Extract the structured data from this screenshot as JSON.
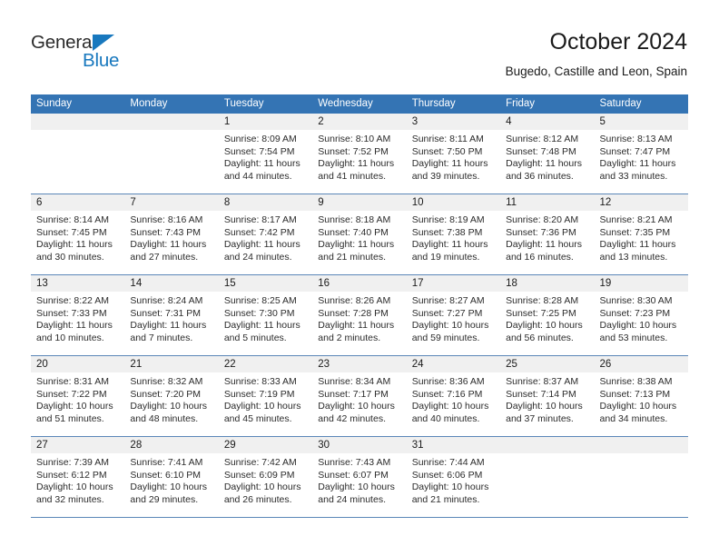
{
  "brand": {
    "name_part1": "General",
    "name_part2": "Blue",
    "accent_color": "#1878be",
    "triangle_icon": "triangle-right-icon"
  },
  "header": {
    "title": "October 2024",
    "subtitle": "Bugedo, Castille and Leon, Spain"
  },
  "theme": {
    "header_blue": "#3474b4",
    "day_band_gray": "#f0f0f0",
    "row_divider": "#5b87b8",
    "text": "#2b2b2b"
  },
  "weekdays": [
    "Sunday",
    "Monday",
    "Tuesday",
    "Wednesday",
    "Thursday",
    "Friday",
    "Saturday"
  ],
  "labels": {
    "sunrise_prefix": "Sunrise:",
    "sunset_prefix": "Sunset:",
    "daylight_prefix": "Daylight:"
  },
  "weeks": [
    [
      {
        "day": "",
        "empty": true,
        "l1": "",
        "l2": "",
        "l3": "",
        "l4": ""
      },
      {
        "day": "",
        "empty": true,
        "l1": "",
        "l2": "",
        "l3": "",
        "l4": ""
      },
      {
        "day": "1",
        "l1": "Sunrise: 8:09 AM",
        "l2": "Sunset: 7:54 PM",
        "l3": "Daylight: 11 hours",
        "l4": "and 44 minutes."
      },
      {
        "day": "2",
        "l1": "Sunrise: 8:10 AM",
        "l2": "Sunset: 7:52 PM",
        "l3": "Daylight: 11 hours",
        "l4": "and 41 minutes."
      },
      {
        "day": "3",
        "l1": "Sunrise: 8:11 AM",
        "l2": "Sunset: 7:50 PM",
        "l3": "Daylight: 11 hours",
        "l4": "and 39 minutes."
      },
      {
        "day": "4",
        "l1": "Sunrise: 8:12 AM",
        "l2": "Sunset: 7:48 PM",
        "l3": "Daylight: 11 hours",
        "l4": "and 36 minutes."
      },
      {
        "day": "5",
        "l1": "Sunrise: 8:13 AM",
        "l2": "Sunset: 7:47 PM",
        "l3": "Daylight: 11 hours",
        "l4": "and 33 minutes."
      }
    ],
    [
      {
        "day": "6",
        "l1": "Sunrise: 8:14 AM",
        "l2": "Sunset: 7:45 PM",
        "l3": "Daylight: 11 hours",
        "l4": "and 30 minutes."
      },
      {
        "day": "7",
        "l1": "Sunrise: 8:16 AM",
        "l2": "Sunset: 7:43 PM",
        "l3": "Daylight: 11 hours",
        "l4": "and 27 minutes."
      },
      {
        "day": "8",
        "l1": "Sunrise: 8:17 AM",
        "l2": "Sunset: 7:42 PM",
        "l3": "Daylight: 11 hours",
        "l4": "and 24 minutes."
      },
      {
        "day": "9",
        "l1": "Sunrise: 8:18 AM",
        "l2": "Sunset: 7:40 PM",
        "l3": "Daylight: 11 hours",
        "l4": "and 21 minutes."
      },
      {
        "day": "10",
        "l1": "Sunrise: 8:19 AM",
        "l2": "Sunset: 7:38 PM",
        "l3": "Daylight: 11 hours",
        "l4": "and 19 minutes."
      },
      {
        "day": "11",
        "l1": "Sunrise: 8:20 AM",
        "l2": "Sunset: 7:36 PM",
        "l3": "Daylight: 11 hours",
        "l4": "and 16 minutes."
      },
      {
        "day": "12",
        "l1": "Sunrise: 8:21 AM",
        "l2": "Sunset: 7:35 PM",
        "l3": "Daylight: 11 hours",
        "l4": "and 13 minutes."
      }
    ],
    [
      {
        "day": "13",
        "l1": "Sunrise: 8:22 AM",
        "l2": "Sunset: 7:33 PM",
        "l3": "Daylight: 11 hours",
        "l4": "and 10 minutes."
      },
      {
        "day": "14",
        "l1": "Sunrise: 8:24 AM",
        "l2": "Sunset: 7:31 PM",
        "l3": "Daylight: 11 hours",
        "l4": "and 7 minutes."
      },
      {
        "day": "15",
        "l1": "Sunrise: 8:25 AM",
        "l2": "Sunset: 7:30 PM",
        "l3": "Daylight: 11 hours",
        "l4": "and 5 minutes."
      },
      {
        "day": "16",
        "l1": "Sunrise: 8:26 AM",
        "l2": "Sunset: 7:28 PM",
        "l3": "Daylight: 11 hours",
        "l4": "and 2 minutes."
      },
      {
        "day": "17",
        "l1": "Sunrise: 8:27 AM",
        "l2": "Sunset: 7:27 PM",
        "l3": "Daylight: 10 hours",
        "l4": "and 59 minutes."
      },
      {
        "day": "18",
        "l1": "Sunrise: 8:28 AM",
        "l2": "Sunset: 7:25 PM",
        "l3": "Daylight: 10 hours",
        "l4": "and 56 minutes."
      },
      {
        "day": "19",
        "l1": "Sunrise: 8:30 AM",
        "l2": "Sunset: 7:23 PM",
        "l3": "Daylight: 10 hours",
        "l4": "and 53 minutes."
      }
    ],
    [
      {
        "day": "20",
        "l1": "Sunrise: 8:31 AM",
        "l2": "Sunset: 7:22 PM",
        "l3": "Daylight: 10 hours",
        "l4": "and 51 minutes."
      },
      {
        "day": "21",
        "l1": "Sunrise: 8:32 AM",
        "l2": "Sunset: 7:20 PM",
        "l3": "Daylight: 10 hours",
        "l4": "and 48 minutes."
      },
      {
        "day": "22",
        "l1": "Sunrise: 8:33 AM",
        "l2": "Sunset: 7:19 PM",
        "l3": "Daylight: 10 hours",
        "l4": "and 45 minutes."
      },
      {
        "day": "23",
        "l1": "Sunrise: 8:34 AM",
        "l2": "Sunset: 7:17 PM",
        "l3": "Daylight: 10 hours",
        "l4": "and 42 minutes."
      },
      {
        "day": "24",
        "l1": "Sunrise: 8:36 AM",
        "l2": "Sunset: 7:16 PM",
        "l3": "Daylight: 10 hours",
        "l4": "and 40 minutes."
      },
      {
        "day": "25",
        "l1": "Sunrise: 8:37 AM",
        "l2": "Sunset: 7:14 PM",
        "l3": "Daylight: 10 hours",
        "l4": "and 37 minutes."
      },
      {
        "day": "26",
        "l1": "Sunrise: 8:38 AM",
        "l2": "Sunset: 7:13 PM",
        "l3": "Daylight: 10 hours",
        "l4": "and 34 minutes."
      }
    ],
    [
      {
        "day": "27",
        "l1": "Sunrise: 7:39 AM",
        "l2": "Sunset: 6:12 PM",
        "l3": "Daylight: 10 hours",
        "l4": "and 32 minutes."
      },
      {
        "day": "28",
        "l1": "Sunrise: 7:41 AM",
        "l2": "Sunset: 6:10 PM",
        "l3": "Daylight: 10 hours",
        "l4": "and 29 minutes."
      },
      {
        "day": "29",
        "l1": "Sunrise: 7:42 AM",
        "l2": "Sunset: 6:09 PM",
        "l3": "Daylight: 10 hours",
        "l4": "and 26 minutes."
      },
      {
        "day": "30",
        "l1": "Sunrise: 7:43 AM",
        "l2": "Sunset: 6:07 PM",
        "l3": "Daylight: 10 hours",
        "l4": "and 24 minutes."
      },
      {
        "day": "31",
        "l1": "Sunrise: 7:44 AM",
        "l2": "Sunset: 6:06 PM",
        "l3": "Daylight: 10 hours",
        "l4": "and 21 minutes."
      },
      {
        "day": "",
        "empty": true,
        "l1": "",
        "l2": "",
        "l3": "",
        "l4": ""
      },
      {
        "day": "",
        "empty": true,
        "l1": "",
        "l2": "",
        "l3": "",
        "l4": ""
      }
    ]
  ]
}
